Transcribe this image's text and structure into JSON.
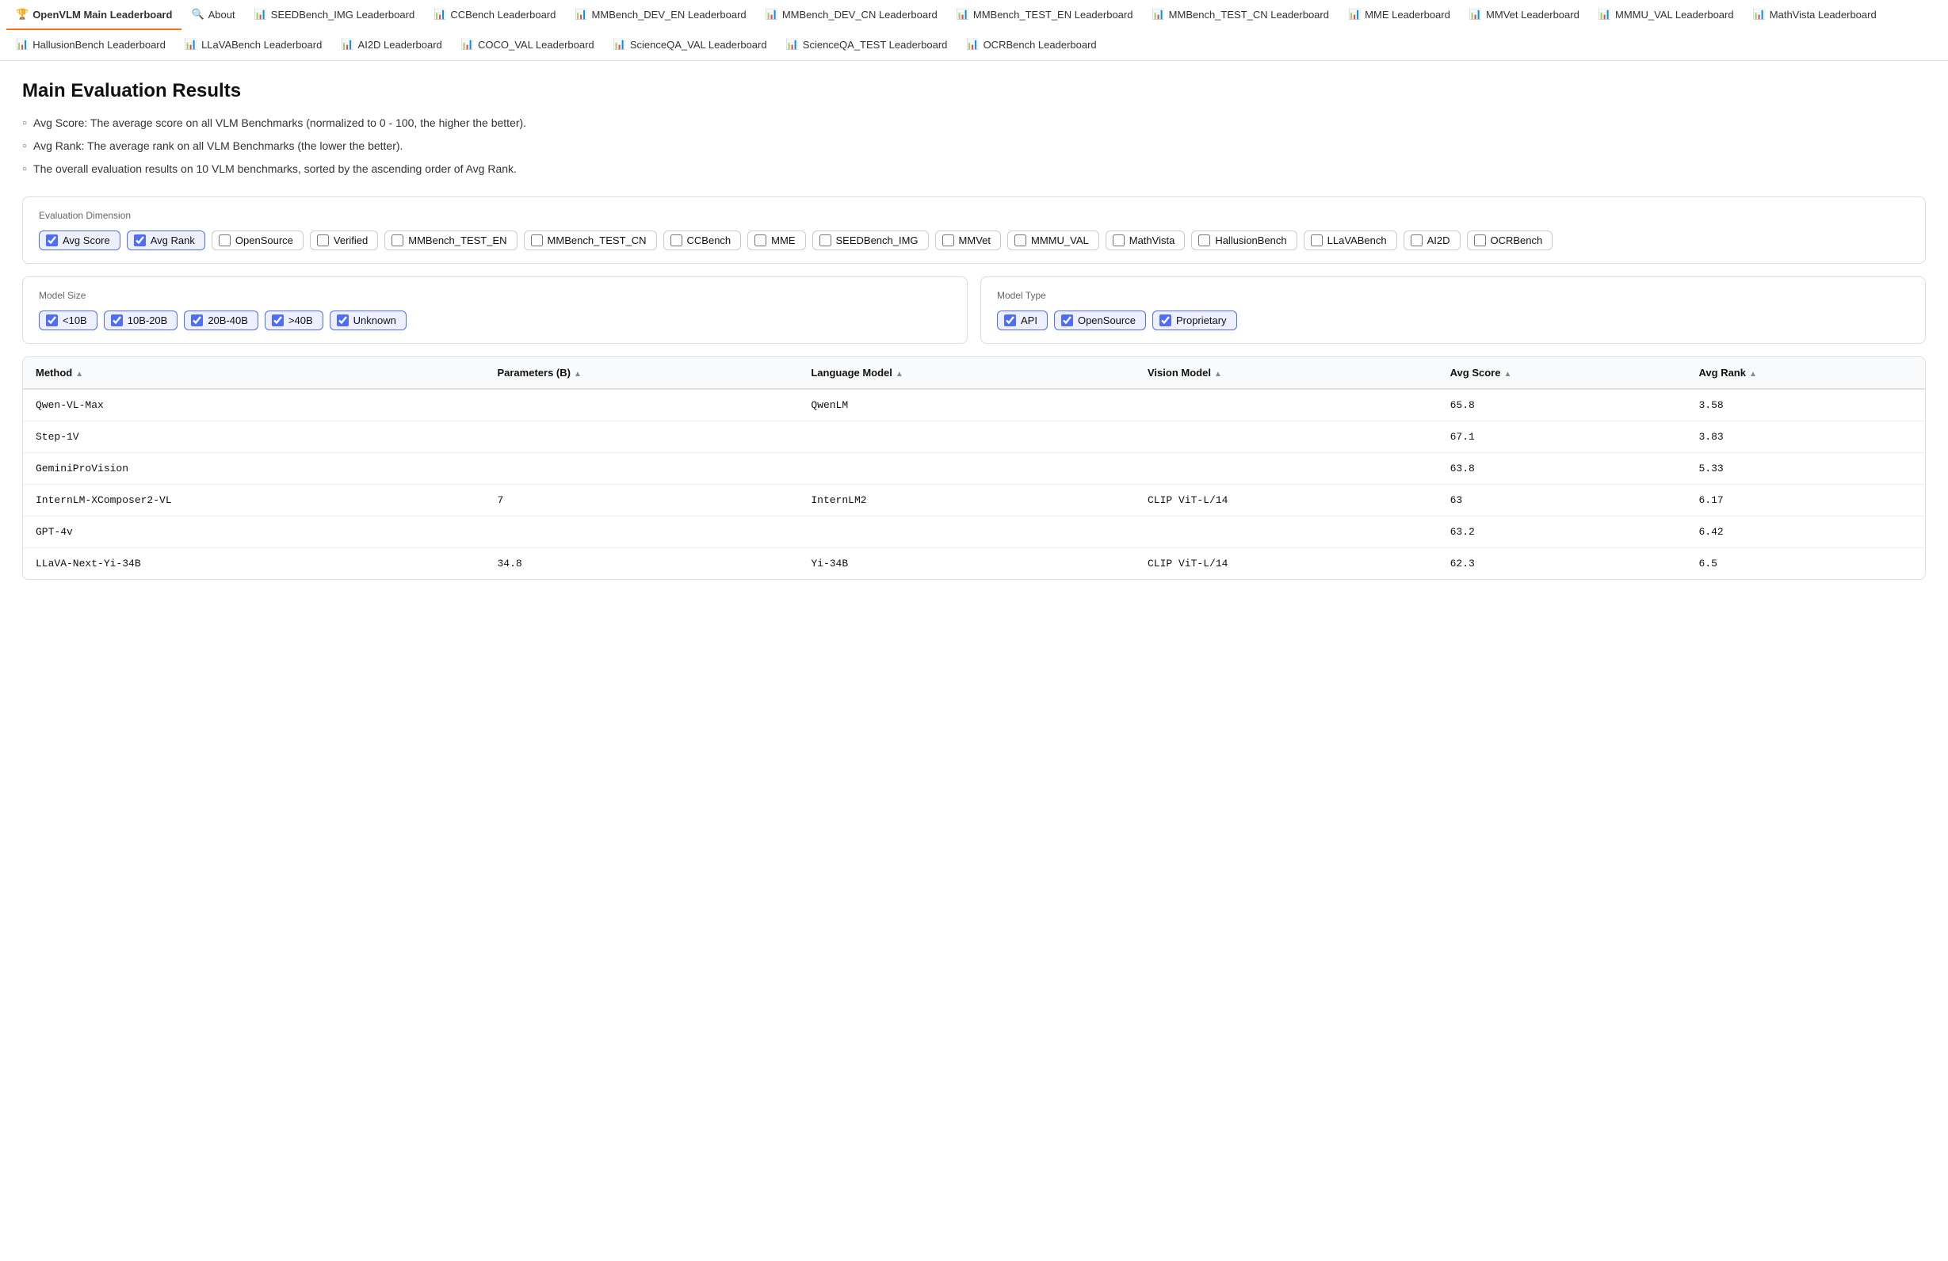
{
  "nav": {
    "tabs": [
      {
        "id": "main-leaderboard",
        "label": "OpenVLM Main Leaderboard",
        "icon": "🏆",
        "active": true
      },
      {
        "id": "about",
        "label": "About",
        "icon": "🔍",
        "active": false
      },
      {
        "id": "seedbench-img",
        "label": "SEEDBench_IMG Leaderboard",
        "icon": "📊",
        "active": false
      },
      {
        "id": "ccbench",
        "label": "CCBench Leaderboard",
        "icon": "📊",
        "active": false
      },
      {
        "id": "mmbench-dev-en",
        "label": "MMBench_DEV_EN Leaderboard",
        "icon": "📊",
        "active": false
      },
      {
        "id": "mmbench-dev-cn",
        "label": "MMBench_DEV_CN Leaderboard",
        "icon": "📊",
        "active": false
      },
      {
        "id": "mmbench-test-en",
        "label": "MMBench_TEST_EN Leaderboard",
        "icon": "📊",
        "active": false
      },
      {
        "id": "mmbench-test-cn",
        "label": "MMBench_TEST_CN Leaderboard",
        "icon": "📊",
        "active": false
      },
      {
        "id": "mme",
        "label": "MME Leaderboard",
        "icon": "📊",
        "active": false
      },
      {
        "id": "mmvet",
        "label": "MMVet Leaderboard",
        "icon": "📊",
        "active": false
      },
      {
        "id": "mmmu-val",
        "label": "MMMU_VAL Leaderboard",
        "icon": "📊",
        "active": false
      },
      {
        "id": "mathvista",
        "label": "MathVista Leaderboard",
        "icon": "📊",
        "active": false
      },
      {
        "id": "hallusionbench",
        "label": "HallusionBench Leaderboard",
        "icon": "📊",
        "active": false
      },
      {
        "id": "llavabench",
        "label": "LLaVABench Leaderboard",
        "icon": "📊",
        "active": false
      },
      {
        "id": "ai2d",
        "label": "AI2D Leaderboard",
        "icon": "📊",
        "active": false
      },
      {
        "id": "coco-val",
        "label": "COCO_VAL Leaderboard",
        "icon": "📊",
        "active": false
      },
      {
        "id": "scienceqa-val",
        "label": "ScienceQA_VAL Leaderboard",
        "icon": "📊",
        "active": false
      },
      {
        "id": "scienceqa-test",
        "label": "ScienceQA_TEST Leaderboard",
        "icon": "📊",
        "active": false
      },
      {
        "id": "ocrbench",
        "label": "OCRBench Leaderboard",
        "icon": "📊",
        "active": false
      }
    ]
  },
  "main": {
    "title": "Main Evaluation Results",
    "descriptions": [
      "Avg Score: The average score on all VLM Benchmarks (normalized to 0 - 100, the higher the better).",
      "Avg Rank: The average rank on all VLM Benchmarks (the lower the better).",
      "The overall evaluation results on 10 VLM benchmarks, sorted by the ascending order of Avg Rank."
    ],
    "eval_dimension": {
      "label": "Evaluation Dimension",
      "options": [
        {
          "id": "avg-score",
          "label": "Avg Score",
          "checked": true
        },
        {
          "id": "avg-rank",
          "label": "Avg Rank",
          "checked": true
        },
        {
          "id": "opensource",
          "label": "OpenSource",
          "checked": false
        },
        {
          "id": "verified",
          "label": "Verified",
          "checked": false
        },
        {
          "id": "mmbench-test-en",
          "label": "MMBench_TEST_EN",
          "checked": false
        },
        {
          "id": "mmbench-test-cn",
          "label": "MMBench_TEST_CN",
          "checked": false
        },
        {
          "id": "ccbench",
          "label": "CCBench",
          "checked": false
        },
        {
          "id": "mme",
          "label": "MME",
          "checked": false
        },
        {
          "id": "seedbench-img",
          "label": "SEEDBench_IMG",
          "checked": false
        },
        {
          "id": "mmvet",
          "label": "MMVet",
          "checked": false
        },
        {
          "id": "mmmu-val",
          "label": "MMMU_VAL",
          "checked": false
        },
        {
          "id": "mathvista",
          "label": "MathVista",
          "checked": false
        },
        {
          "id": "hallusionbench",
          "label": "HallusionBench",
          "checked": false
        },
        {
          "id": "llavabench",
          "label": "LLaVABench",
          "checked": false
        },
        {
          "id": "ai2d",
          "label": "AI2D",
          "checked": false
        },
        {
          "id": "ocrbench",
          "label": "OCRBench",
          "checked": false
        }
      ]
    },
    "model_size": {
      "label": "Model Size",
      "options": [
        {
          "id": "lt10b",
          "label": "<10B",
          "checked": true
        },
        {
          "id": "10b-20b",
          "label": "10B-20B",
          "checked": true
        },
        {
          "id": "20b-40b",
          "label": "20B-40B",
          "checked": true
        },
        {
          "id": "gt40b",
          "label": ">40B",
          "checked": true
        },
        {
          "id": "unknown",
          "label": "Unknown",
          "checked": true
        }
      ]
    },
    "model_type": {
      "label": "Model Type",
      "options": [
        {
          "id": "api",
          "label": "API",
          "checked": true
        },
        {
          "id": "opensource",
          "label": "OpenSource",
          "checked": true
        },
        {
          "id": "proprietary",
          "label": "Proprietary",
          "checked": true
        }
      ]
    },
    "table": {
      "columns": [
        {
          "id": "method",
          "label": "Method",
          "sortable": true
        },
        {
          "id": "parameters",
          "label": "Parameters (B)",
          "sortable": true
        },
        {
          "id": "language-model",
          "label": "Language Model",
          "sortable": true
        },
        {
          "id": "vision-model",
          "label": "Vision Model",
          "sortable": true
        },
        {
          "id": "avg-score",
          "label": "Avg Score",
          "sortable": true
        },
        {
          "id": "avg-rank",
          "label": "Avg Rank",
          "sortable": true
        }
      ],
      "rows": [
        {
          "method": "Qwen-VL-Max",
          "parameters": "",
          "language_model": "QwenLM",
          "vision_model": "",
          "avg_score": "65.8",
          "avg_rank": "3.58"
        },
        {
          "method": "Step-1V",
          "parameters": "",
          "language_model": "",
          "vision_model": "",
          "avg_score": "67.1",
          "avg_rank": "3.83"
        },
        {
          "method": "GeminiProVision",
          "parameters": "",
          "language_model": "",
          "vision_model": "",
          "avg_score": "63.8",
          "avg_rank": "5.33"
        },
        {
          "method": "InternLM-XComposer2-VL",
          "parameters": "7",
          "language_model": "InternLM2",
          "vision_model": "CLIP ViT-L/14",
          "avg_score": "63",
          "avg_rank": "6.17"
        },
        {
          "method": "GPT-4v",
          "parameters": "",
          "language_model": "",
          "vision_model": "",
          "avg_score": "63.2",
          "avg_rank": "6.42"
        },
        {
          "method": "LLaVA-Next-Yi-34B",
          "parameters": "34.8",
          "language_model": "Yi-34B",
          "vision_model": "CLIP ViT-L/14",
          "avg_score": "62.3",
          "avg_rank": "6.5"
        }
      ]
    }
  }
}
